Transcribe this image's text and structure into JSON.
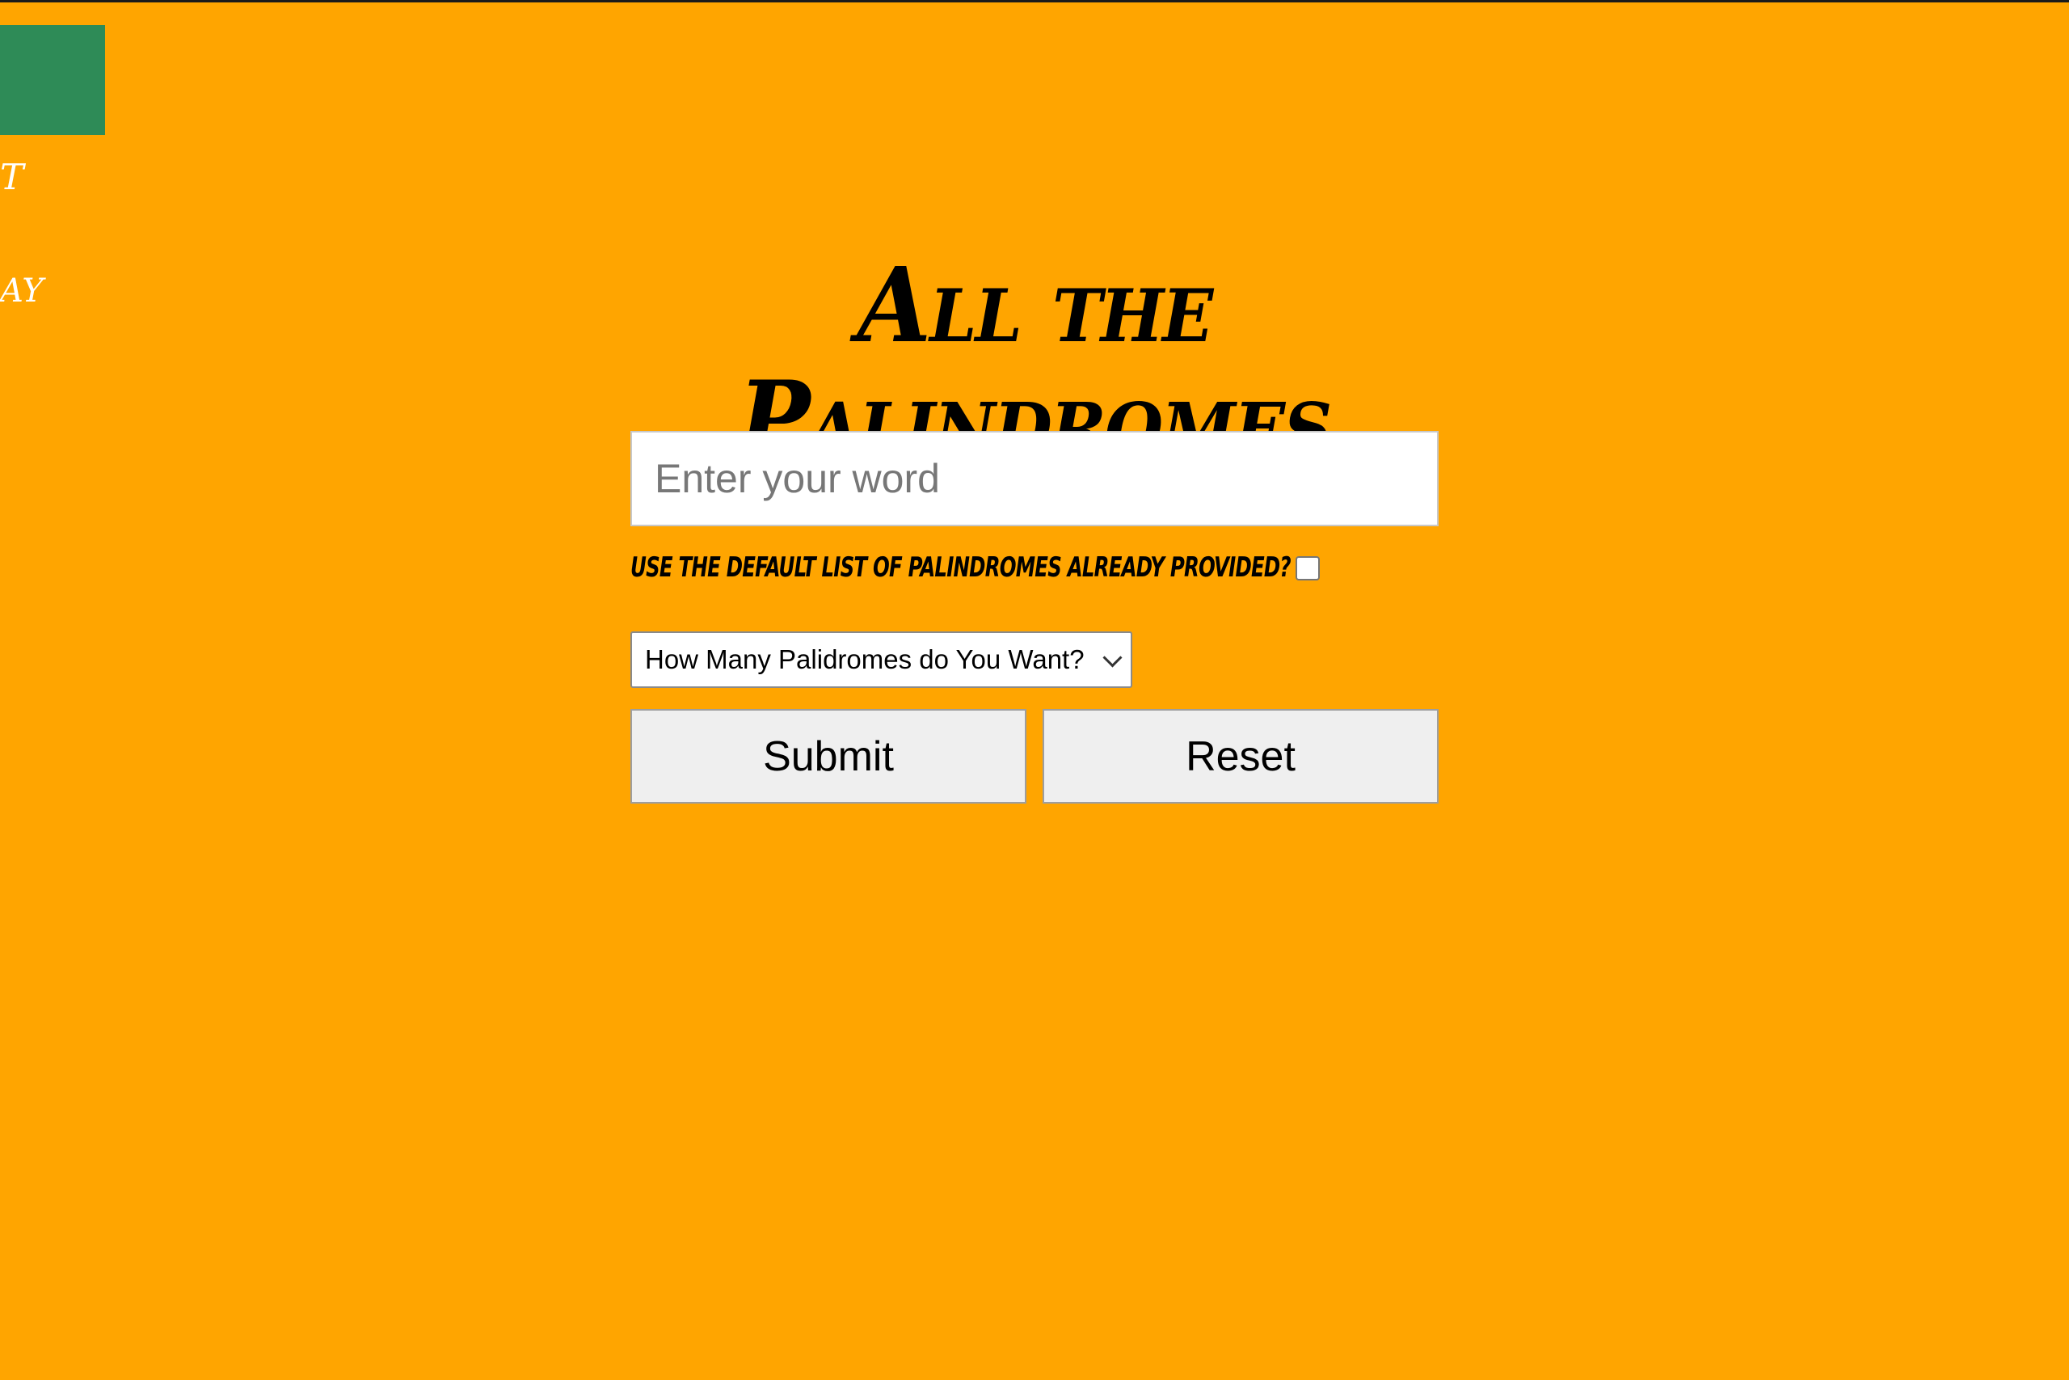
{
  "sidebar": {
    "fragment_top": "T",
    "fragment_bottom": "AY"
  },
  "page": {
    "title": "All the Palindromes"
  },
  "form": {
    "word_placeholder": "Enter your word",
    "word_value": "",
    "default_list_label": "Use the default list of Palindromes already provided?",
    "default_list_checked": false,
    "count_select_value": "How Many Palidromes do You Want?",
    "submit_label": "Submit",
    "reset_label": "Reset"
  },
  "colors": {
    "background": "#FFA500",
    "side_tab": "#2E8B57",
    "button_bg": "#EFEFEF",
    "title_text": "#000000"
  },
  "icons": {
    "select_arrow": "chevron-down-icon"
  }
}
